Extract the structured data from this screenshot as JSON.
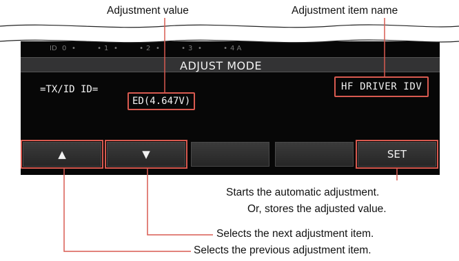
{
  "callouts": {
    "adjustment_value": "Adjustment value",
    "adjustment_item_name": "Adjustment item name",
    "set_line1": "Starts the automatic adjustment.",
    "set_line2": "Or, stores the adjusted value.",
    "down_desc": "Selects the next adjustment item.",
    "up_desc": "Selects the previous adjustment item."
  },
  "screen": {
    "meter_label": "ID",
    "meter_ticks": [
      "0",
      "1",
      "2",
      "3",
      "4 A"
    ],
    "mode_title": "ADJUST MODE",
    "parameter": "=TX/ID ID=",
    "value": "ED(4.647V)",
    "item_name": "HF DRIVER IDV"
  },
  "softkeys": {
    "up": "▲",
    "down": "▼",
    "key3": "",
    "key4": "",
    "set": "SET"
  },
  "colors": {
    "highlight": "#d95a50",
    "screen_bg": "#070707",
    "key_bg": "#2f2f2f"
  }
}
